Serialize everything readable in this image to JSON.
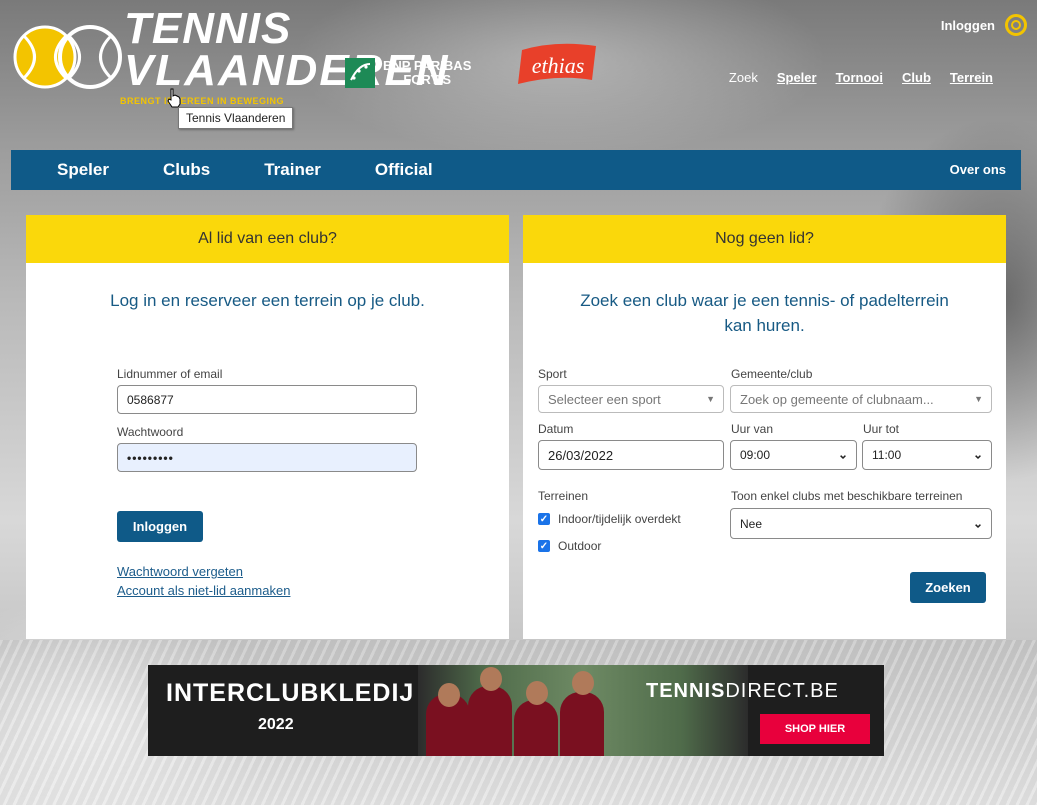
{
  "header": {
    "logo": {
      "line1": "TENNIS",
      "line2": "VLAANDEREN",
      "tagline": "BRENGT IEDEREEN IN BEWEGING"
    },
    "tooltip": "Tennis Vlaanderen",
    "sponsors": {
      "bnp_line1": "BNP PARIBAS",
      "bnp_line2": "FORTIS",
      "ethias": "ethias"
    },
    "login_label": "Inloggen",
    "search_label": "Zoek",
    "search_links": [
      "Speler",
      "Tornooi",
      "Club",
      "Terrein"
    ]
  },
  "mainnav": {
    "items": [
      "Speler",
      "Clubs",
      "Trainer",
      "Official"
    ],
    "about": "Over ons"
  },
  "login_card": {
    "heading": "Al lid van een club?",
    "intro": "Log in en reserveer een terrein op je club.",
    "user_label": "Lidnummer of email",
    "user_value": "0586877",
    "password_label": "Wachtwoord",
    "password_value": "•••••••••",
    "submit_label": "Inloggen",
    "forgot_link": "Wachtwoord vergeten",
    "register_link": "Account als niet-lid aanmaken"
  },
  "search_card": {
    "heading": "Nog geen lid?",
    "intro_line1": "Zoek een club waar je een tennis- of padelterrein",
    "intro_line2": "kan huren.",
    "sport_label": "Sport",
    "sport_placeholder": "Selecteer een sport",
    "club_label": "Gemeente/club",
    "club_placeholder": "Zoek op gemeente of clubnaam...",
    "date_label": "Datum",
    "date_value": "26/03/2022",
    "from_label": "Uur van",
    "from_value": "09:00",
    "to_label": "Uur tot",
    "to_value": "11:00",
    "courts_label": "Terreinen",
    "court_options": [
      {
        "label": "Indoor/tijdelijk overdekt",
        "checked": true
      },
      {
        "label": "Outdoor",
        "checked": true
      }
    ],
    "available_label": "Toon enkel clubs met beschikbare terreinen",
    "available_value": "Nee",
    "submit_label": "Zoeken"
  },
  "banner": {
    "title": "INTERCLUBKLEDIJ",
    "year": "2022",
    "brand_bold": "TENNIS",
    "brand_rest": "DIRECT.BE",
    "cta": "SHOP HIER"
  },
  "colors": {
    "nav_blue": "#0f5a88",
    "yellow": "#fad80b",
    "link": "#1c5c8b",
    "shop_red": "#e8003c"
  }
}
